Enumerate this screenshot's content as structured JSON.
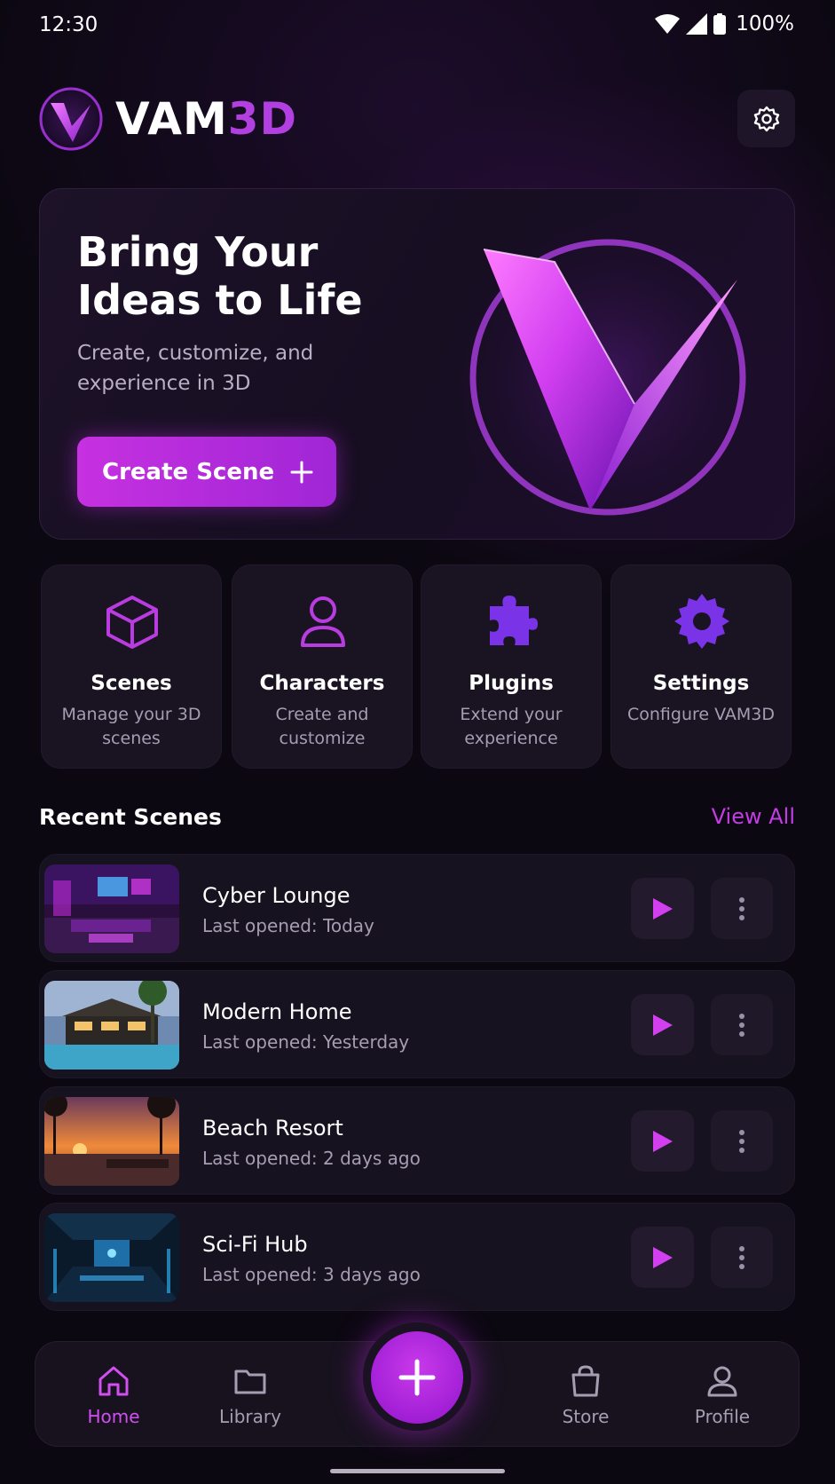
{
  "status_bar": {
    "time": "12:30",
    "battery": "100%"
  },
  "header": {
    "title_part1": "VAM",
    "title_part2": "3D"
  },
  "hero": {
    "title": "Bring Your Ideas to Life",
    "subtitle": "Create, customize, and experience in 3D",
    "cta_label": "Create Scene"
  },
  "quick_actions": [
    {
      "title": "Scenes",
      "desc": "Manage your 3D scenes",
      "icon": "cube-icon"
    },
    {
      "title": "Characters",
      "desc": "Create and customize",
      "icon": "person-icon"
    },
    {
      "title": "Plugins",
      "desc": "Extend your experience",
      "icon": "puzzle-icon"
    },
    {
      "title": "Settings",
      "desc": "Configure VAM3D",
      "icon": "gear-icon"
    }
  ],
  "recent": {
    "title": "Recent Scenes",
    "view_all": "View All",
    "scenes": [
      {
        "name": "Cyber Lounge",
        "time": "Last opened: Today"
      },
      {
        "name": "Modern Home",
        "time": "Last opened: Yesterday"
      },
      {
        "name": "Beach Resort",
        "time": "Last opened: 2 days ago"
      },
      {
        "name": "Sci-Fi Hub",
        "time": "Last opened: 3 days ago"
      }
    ]
  },
  "nav": {
    "items": [
      {
        "label": "Home",
        "icon": "home-icon",
        "active": true
      },
      {
        "label": "Library",
        "icon": "folder-icon"
      },
      {
        "label": "Store",
        "icon": "shopping-bag-icon"
      },
      {
        "label": "Profile",
        "icon": "profile-icon"
      }
    ],
    "fab_icon": "plus-icon"
  },
  "colors": {
    "accent": "#c43ce6",
    "background": "#0c0812",
    "card": "#1a1322"
  }
}
